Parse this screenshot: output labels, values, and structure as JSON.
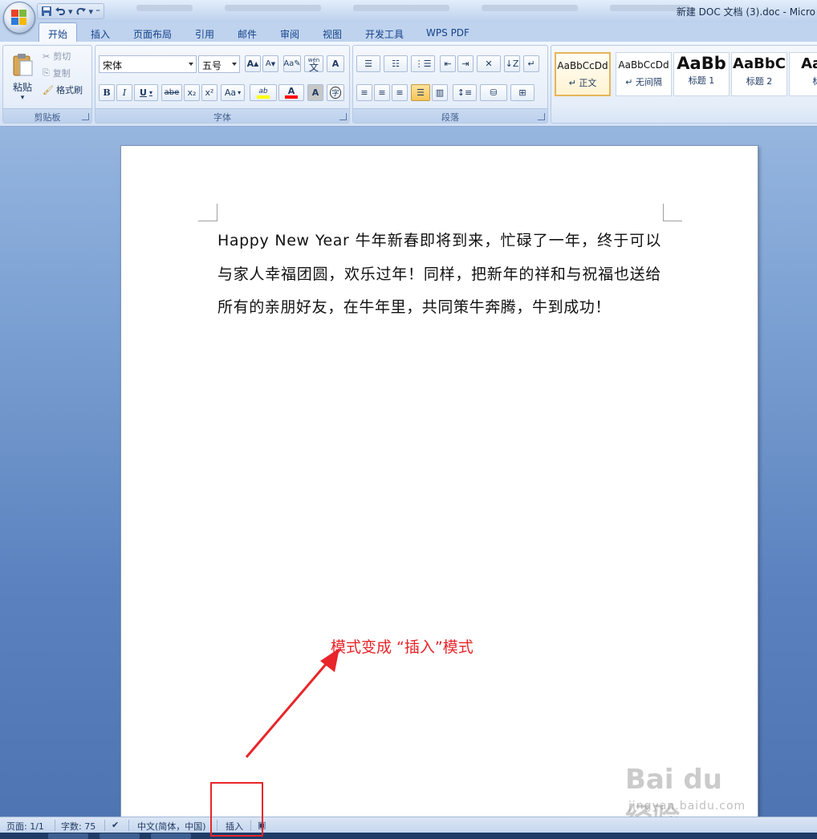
{
  "window": {
    "title": "新建 DOC 文档 (3).doc - Micro"
  },
  "ribbon": {
    "tabs": [
      "开始",
      "插入",
      "页面布局",
      "引用",
      "邮件",
      "审阅",
      "视图",
      "开发工具",
      "WPS PDF"
    ],
    "active_tab": "开始",
    "clipboard": {
      "paste": "粘贴",
      "cut": "剪切",
      "copy": "复制",
      "format_painter": "格式刷",
      "group_label": "剪贴板"
    },
    "font": {
      "font_name": "宋体",
      "font_size": "五号",
      "group_label": "字体",
      "grow": "A",
      "shrink": "A",
      "phonetic": "wén",
      "phonetic_char": "文",
      "border_char": "A",
      "bold": "B",
      "italic": "I",
      "underline": "U",
      "strike": "abe",
      "subscript": "x₂",
      "superscript": "x²",
      "change_case": "Aa",
      "highlight": "ab",
      "font_color": "A",
      "shading": "A",
      "enclose": "字"
    },
    "paragraph": {
      "group_label": "段落"
    },
    "styles": [
      {
        "sample": "AaBbCcDd",
        "name": "↵ 正文"
      },
      {
        "sample": "AaBbCcDd",
        "name": "↵ 无间隔"
      },
      {
        "sample": "AaBb",
        "name": "标题 1"
      },
      {
        "sample": "AaBbC",
        "name": "标题 2"
      },
      {
        "sample": "AaB",
        "name": "标"
      }
    ]
  },
  "document": {
    "body": "Happy New Year 牛年新春即将到来，忙碌了一年，终于可以与家人幸福团圆，欢乐过年！同样，把新年的祥和与祝福也送给所有的亲朋好友，在牛年里，共同策牛奔腾，牛到成功！"
  },
  "annotation": {
    "text": "模式变成 “插入”模式",
    "color": "#e8252a"
  },
  "watermark": {
    "main": "Bai du 经验",
    "sub": "jingyan.baidu.com"
  },
  "statusbar": {
    "page": "页面: 1/1",
    "words": "字数: 75",
    "language": "中文(简体，中国)",
    "mode": "插入"
  },
  "colors": {
    "accent": "#15428b",
    "highlight_yellow": "#ffff00",
    "font_red": "#ff0000"
  }
}
